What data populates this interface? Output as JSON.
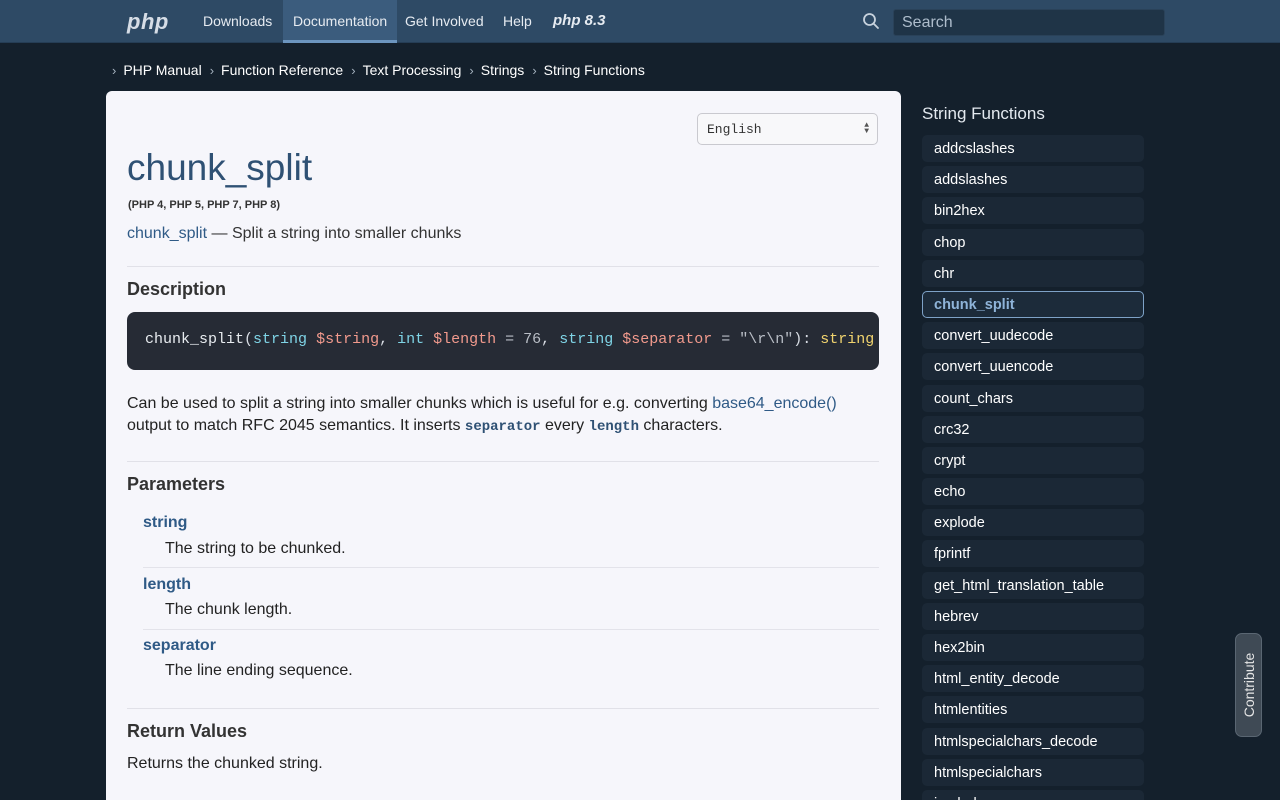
{
  "nav": {
    "logo": "php",
    "items": [
      "Downloads",
      "Documentation",
      "Get Involved",
      "Help"
    ],
    "version_logo": "php 8.3",
    "search_placeholder": "Search"
  },
  "breadcrumb": [
    "PHP Manual",
    "Function Reference",
    "Text Processing",
    "Strings",
    "String Functions"
  ],
  "main": {
    "language": "English",
    "title": "chunk_split",
    "versions": "(PHP 4, PHP 5, PHP 7, PHP 8)",
    "refname": "chunk_split",
    "refpurpose": " — Split a string into smaller chunks",
    "description_heading": "Description",
    "signature": {
      "fn": "chunk_split",
      "p1_type": "string",
      "p1_var": "$string",
      "p2_type": "int",
      "p2_var": "$length",
      "p2_default": " = 76",
      "p3_type": "string",
      "p3_var": "$separator",
      "p3_default": " = \"\\r\\n\"",
      "return_type": "string"
    },
    "desc": {
      "t1": "Can be used to split a string into smaller chunks which is useful for e.g. converting ",
      "link": "base64_encode()",
      "t2": " output to match RFC 2045 semantics. It inserts ",
      "code1": "separator",
      "t3": " every ",
      "code2": "length",
      "t4": " characters."
    },
    "parameters_heading": "Parameters",
    "parameters": [
      {
        "name": "string",
        "desc": "The string to be chunked."
      },
      {
        "name": "length",
        "desc": "The chunk length."
      },
      {
        "name": "separator",
        "desc": "The line ending sequence."
      }
    ],
    "return_heading": "Return Values",
    "return_text": "Returns the chunked string."
  },
  "sidebar": {
    "title": "String Functions",
    "items": [
      "addcslashes",
      "addslashes",
      "bin2hex",
      "chop",
      "chr",
      "chunk_split",
      "convert_uudecode",
      "convert_uuencode",
      "count_chars",
      "crc32",
      "crypt",
      "echo",
      "explode",
      "fprintf",
      "get_html_translation_table",
      "hebrev",
      "hex2bin",
      "html_entity_decode",
      "htmlentities",
      "htmlspecialchars_decode",
      "htmlspecialchars",
      "implode"
    ],
    "current": "chunk_split"
  },
  "contribute_label": "Contribute"
}
